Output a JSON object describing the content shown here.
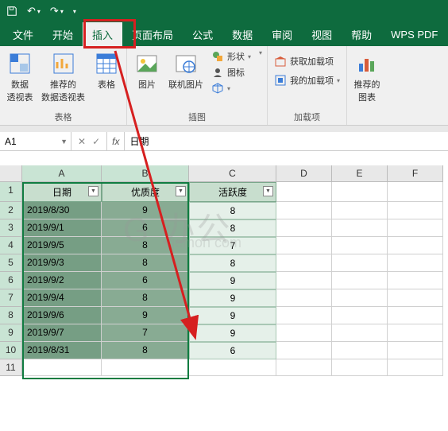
{
  "qat": {
    "save": "",
    "undo": "",
    "redo": ""
  },
  "tabs": {
    "file": "文件",
    "home": "开始",
    "insert": "插入",
    "layout": "页面布局",
    "formulas": "公式",
    "data": "数据",
    "review": "审阅",
    "view": "视图",
    "help": "帮助",
    "wps": "WPS PDF"
  },
  "ribbon": {
    "group_tables": "表格",
    "pivot": "数据\n透视表",
    "rec_pivot": "推荐的\n数据透视表",
    "table": "表格",
    "group_illus": "插图",
    "picture": "图片",
    "online_pic": "联机图片",
    "shapes": "形状",
    "icons": "图标",
    "threed": "",
    "group_addins": "加载项",
    "get_addins": "获取加载项",
    "my_addins": "我的加载项",
    "group_charts": "",
    "rec_charts": "推荐的\n图表"
  },
  "namebox": "A1",
  "formula": "日期",
  "columns": [
    "A",
    "B",
    "C",
    "D",
    "E",
    "F"
  ],
  "headers": {
    "date": "日期",
    "quality": "优质度",
    "activity": "活跃度"
  },
  "rows": [
    {
      "date": "2019/8/30",
      "quality": "9",
      "activity": "8"
    },
    {
      "date": "2019/9/1",
      "quality": "6",
      "activity": "8"
    },
    {
      "date": "2019/9/5",
      "quality": "8",
      "activity": "7"
    },
    {
      "date": "2019/9/3",
      "quality": "8",
      "activity": "8"
    },
    {
      "date": "2019/9/2",
      "quality": "6",
      "activity": "9"
    },
    {
      "date": "2019/9/4",
      "quality": "8",
      "activity": "9"
    },
    {
      "date": "2019/9/6",
      "quality": "9",
      "activity": "9"
    },
    {
      "date": "2019/9/7",
      "quality": "7",
      "activity": "9"
    },
    {
      "date": "2019/8/31",
      "quality": "8",
      "activity": "6"
    }
  ],
  "chart_data": {
    "type": "table",
    "title": "",
    "columns": [
      "日期",
      "优质度",
      "活跃度"
    ],
    "data": [
      [
        "2019/8/30",
        9,
        8
      ],
      [
        "2019/9/1",
        6,
        8
      ],
      [
        "2019/9/5",
        8,
        7
      ],
      [
        "2019/9/3",
        8,
        8
      ],
      [
        "2019/9/2",
        6,
        9
      ],
      [
        "2019/9/4",
        8,
        9
      ],
      [
        "2019/9/6",
        9,
        9
      ],
      [
        "2019/9/7",
        7,
        9
      ],
      [
        "2019/8/31",
        8,
        6
      ]
    ]
  }
}
